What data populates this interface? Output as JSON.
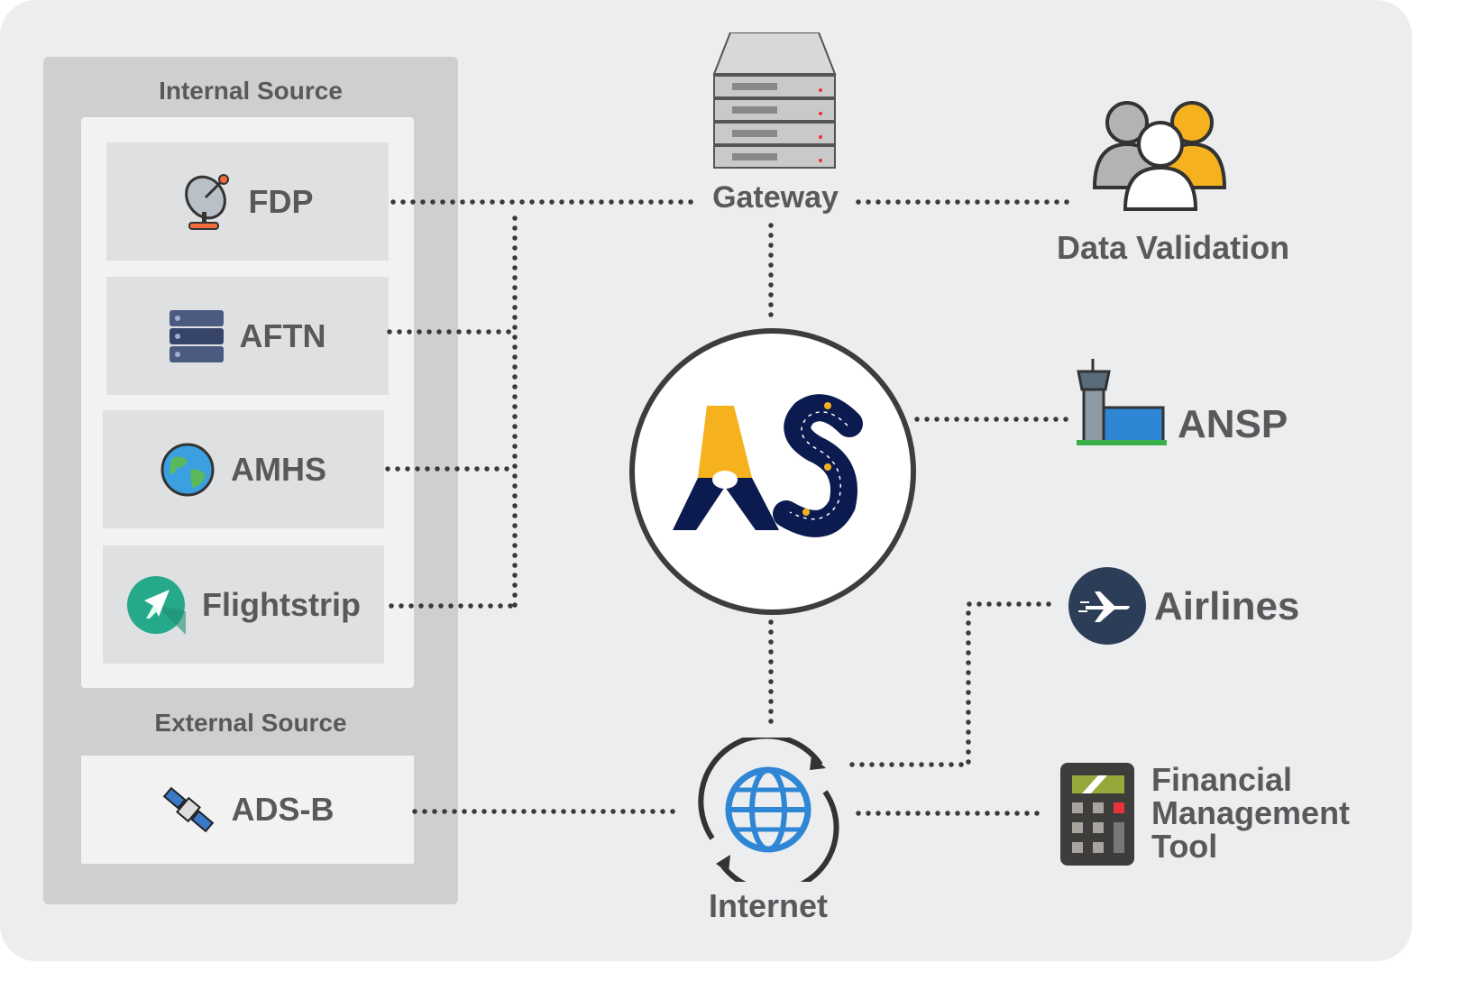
{
  "internal_source": {
    "title": "Internal Source",
    "items": [
      {
        "label": "FDP",
        "icon": "satellite-dish-icon"
      },
      {
        "label": "AFTN",
        "icon": "server-rack-icon"
      },
      {
        "label": "AMHS",
        "icon": "globe-icon"
      },
      {
        "label": "Flightstrip",
        "icon": "airplane-circle-icon"
      }
    ]
  },
  "external_source": {
    "title": "External Source",
    "items": [
      {
        "label": "ADS-B",
        "icon": "satellite-icon"
      }
    ]
  },
  "center": {
    "logo_text": "AS",
    "colors": {
      "yellow": "#f5b21e",
      "navy": "#0b1a4f"
    }
  },
  "nodes": {
    "gateway": {
      "label": "Gateway",
      "icon": "server-stack-icon"
    },
    "internet": {
      "label": "Internet",
      "icon": "globe-sync-icon"
    },
    "data_validation": {
      "label": "Data Validation",
      "icon": "users-group-icon"
    },
    "ansp": {
      "label": "ANSP",
      "icon": "control-tower-icon"
    },
    "airlines": {
      "label": "Airlines",
      "icon": "airplane-icon"
    },
    "financial": {
      "line1": "Financial",
      "line2": "Management",
      "line3": "Tool",
      "icon": "calculator-icon"
    }
  },
  "colors": {
    "background": "#ecedef",
    "connector": "#3a3a3a",
    "text": "#58595b"
  }
}
